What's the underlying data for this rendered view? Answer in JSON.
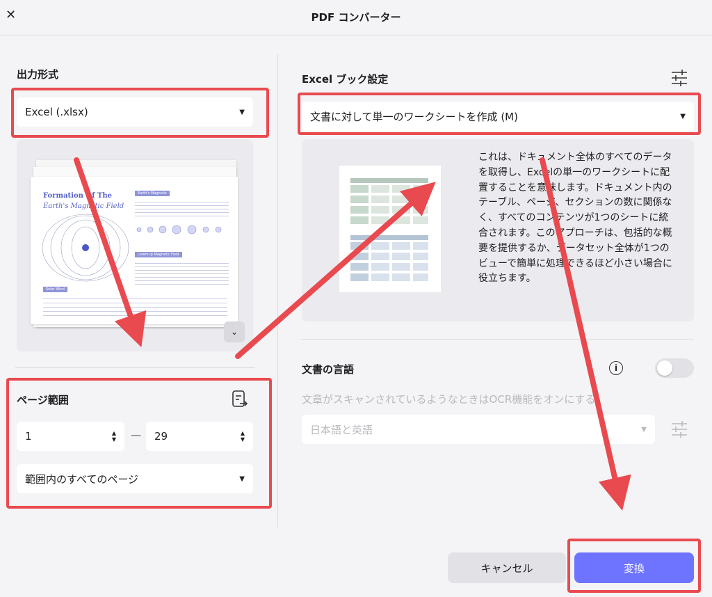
{
  "window": {
    "title": "PDF コンバーター",
    "close_icon": "close-icon"
  },
  "output": {
    "label": "出力形式",
    "format_value": "Excel (.xlsx)",
    "preview": {
      "doc_title_line1": "Formation Of The",
      "doc_title_line2": "Earth's Magnetic Field",
      "badge1": "Earth's Magnetic",
      "badge2": "Lorem Ip Magnetic Field",
      "badge3": "Solar Wind"
    }
  },
  "page_range": {
    "label": "ページ範囲",
    "from": "1",
    "separator": "—",
    "to": "29",
    "subset_value": "範囲内のすべてのページ"
  },
  "excel": {
    "label": "Excel ブック設定",
    "sheet_mode_value": "文書に対して単一のワークシートを作成 (M)",
    "description": "これは、ドキュメント全体のすべてのデータを取得し、Excelの単一のワークシートに配置することを意味します。ドキュメント内のテーブル、ページ、セクションの数に関係なく、すべてのコンテンツが1つのシートに統合されます。このアプローチは、包括的な概要を提供するか、データセット全体が1つのビューで簡単に処理できるほど小さい場合に役立ちます。"
  },
  "language": {
    "label": "文書の言語",
    "ocr_hint": "文章がスキャンされているようなときはOCR機能をオンにする",
    "value": "日本語と英語",
    "ocr_enabled": false
  },
  "buttons": {
    "cancel": "キャンセル",
    "convert": "変換"
  },
  "colors": {
    "accent": "#6e74ff",
    "highlight": "#e94a4f"
  }
}
